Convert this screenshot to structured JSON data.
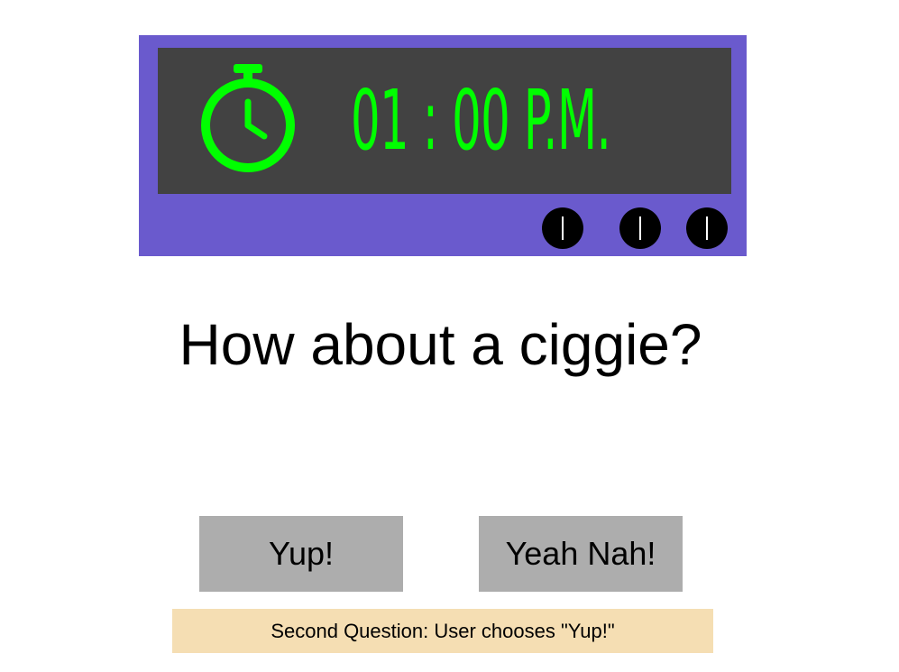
{
  "clock": {
    "time_text": "01 : 00 P.M.",
    "icon": "stopwatch-icon",
    "colors": {
      "body": "#6a5acd",
      "screen": "#424242",
      "digits": "#00ff00",
      "knobs": "#000000"
    }
  },
  "question": {
    "text": "How about a ciggie?"
  },
  "buttons": {
    "yes_label": "Yup!",
    "no_label": "Yeah Nah!"
  },
  "caption": {
    "text": "Second Question: User chooses \"Yup!\""
  }
}
